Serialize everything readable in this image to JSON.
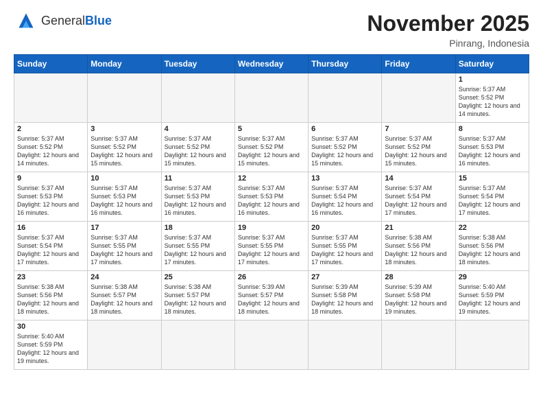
{
  "header": {
    "logo_general": "General",
    "logo_blue": "Blue",
    "month_title": "November 2025",
    "location": "Pinrang, Indonesia"
  },
  "weekdays": [
    "Sunday",
    "Monday",
    "Tuesday",
    "Wednesday",
    "Thursday",
    "Friday",
    "Saturday"
  ],
  "days": [
    {
      "num": "",
      "empty": true
    },
    {
      "num": "",
      "empty": true
    },
    {
      "num": "",
      "empty": true
    },
    {
      "num": "",
      "empty": true
    },
    {
      "num": "",
      "empty": true
    },
    {
      "num": "",
      "empty": true
    },
    {
      "num": "1",
      "sunrise": "5:37 AM",
      "sunset": "5:52 PM",
      "daylight": "12 hours and 14 minutes."
    },
    {
      "num": "2",
      "sunrise": "5:37 AM",
      "sunset": "5:52 PM",
      "daylight": "12 hours and 14 minutes."
    },
    {
      "num": "3",
      "sunrise": "5:37 AM",
      "sunset": "5:52 PM",
      "daylight": "12 hours and 15 minutes."
    },
    {
      "num": "4",
      "sunrise": "5:37 AM",
      "sunset": "5:52 PM",
      "daylight": "12 hours and 15 minutes."
    },
    {
      "num": "5",
      "sunrise": "5:37 AM",
      "sunset": "5:52 PM",
      "daylight": "12 hours and 15 minutes."
    },
    {
      "num": "6",
      "sunrise": "5:37 AM",
      "sunset": "5:52 PM",
      "daylight": "12 hours and 15 minutes."
    },
    {
      "num": "7",
      "sunrise": "5:37 AM",
      "sunset": "5:52 PM",
      "daylight": "12 hours and 15 minutes."
    },
    {
      "num": "8",
      "sunrise": "5:37 AM",
      "sunset": "5:53 PM",
      "daylight": "12 hours and 16 minutes."
    },
    {
      "num": "9",
      "sunrise": "5:37 AM",
      "sunset": "5:53 PM",
      "daylight": "12 hours and 16 minutes."
    },
    {
      "num": "10",
      "sunrise": "5:37 AM",
      "sunset": "5:53 PM",
      "daylight": "12 hours and 16 minutes."
    },
    {
      "num": "11",
      "sunrise": "5:37 AM",
      "sunset": "5:53 PM",
      "daylight": "12 hours and 16 minutes."
    },
    {
      "num": "12",
      "sunrise": "5:37 AM",
      "sunset": "5:53 PM",
      "daylight": "12 hours and 16 minutes."
    },
    {
      "num": "13",
      "sunrise": "5:37 AM",
      "sunset": "5:54 PM",
      "daylight": "12 hours and 16 minutes."
    },
    {
      "num": "14",
      "sunrise": "5:37 AM",
      "sunset": "5:54 PM",
      "daylight": "12 hours and 17 minutes."
    },
    {
      "num": "15",
      "sunrise": "5:37 AM",
      "sunset": "5:54 PM",
      "daylight": "12 hours and 17 minutes."
    },
    {
      "num": "16",
      "sunrise": "5:37 AM",
      "sunset": "5:54 PM",
      "daylight": "12 hours and 17 minutes."
    },
    {
      "num": "17",
      "sunrise": "5:37 AM",
      "sunset": "5:55 PM",
      "daylight": "12 hours and 17 minutes."
    },
    {
      "num": "18",
      "sunrise": "5:37 AM",
      "sunset": "5:55 PM",
      "daylight": "12 hours and 17 minutes."
    },
    {
      "num": "19",
      "sunrise": "5:37 AM",
      "sunset": "5:55 PM",
      "daylight": "12 hours and 17 minutes."
    },
    {
      "num": "20",
      "sunrise": "5:37 AM",
      "sunset": "5:55 PM",
      "daylight": "12 hours and 17 minutes."
    },
    {
      "num": "21",
      "sunrise": "5:38 AM",
      "sunset": "5:56 PM",
      "daylight": "12 hours and 18 minutes."
    },
    {
      "num": "22",
      "sunrise": "5:38 AM",
      "sunset": "5:56 PM",
      "daylight": "12 hours and 18 minutes."
    },
    {
      "num": "23",
      "sunrise": "5:38 AM",
      "sunset": "5:56 PM",
      "daylight": "12 hours and 18 minutes."
    },
    {
      "num": "24",
      "sunrise": "5:38 AM",
      "sunset": "5:57 PM",
      "daylight": "12 hours and 18 minutes."
    },
    {
      "num": "25",
      "sunrise": "5:38 AM",
      "sunset": "5:57 PM",
      "daylight": "12 hours and 18 minutes."
    },
    {
      "num": "26",
      "sunrise": "5:39 AM",
      "sunset": "5:57 PM",
      "daylight": "12 hours and 18 minutes."
    },
    {
      "num": "27",
      "sunrise": "5:39 AM",
      "sunset": "5:58 PM",
      "daylight": "12 hours and 18 minutes."
    },
    {
      "num": "28",
      "sunrise": "5:39 AM",
      "sunset": "5:58 PM",
      "daylight": "12 hours and 19 minutes."
    },
    {
      "num": "29",
      "sunrise": "5:40 AM",
      "sunset": "5:59 PM",
      "daylight": "12 hours and 19 minutes."
    },
    {
      "num": "30",
      "sunrise": "5:40 AM",
      "sunset": "5:59 PM",
      "daylight": "12 hours and 19 minutes."
    },
    {
      "num": "",
      "empty": true
    },
    {
      "num": "",
      "empty": true
    },
    {
      "num": "",
      "empty": true
    },
    {
      "num": "",
      "empty": true
    },
    {
      "num": "",
      "empty": true
    },
    {
      "num": "",
      "empty": true
    }
  ]
}
